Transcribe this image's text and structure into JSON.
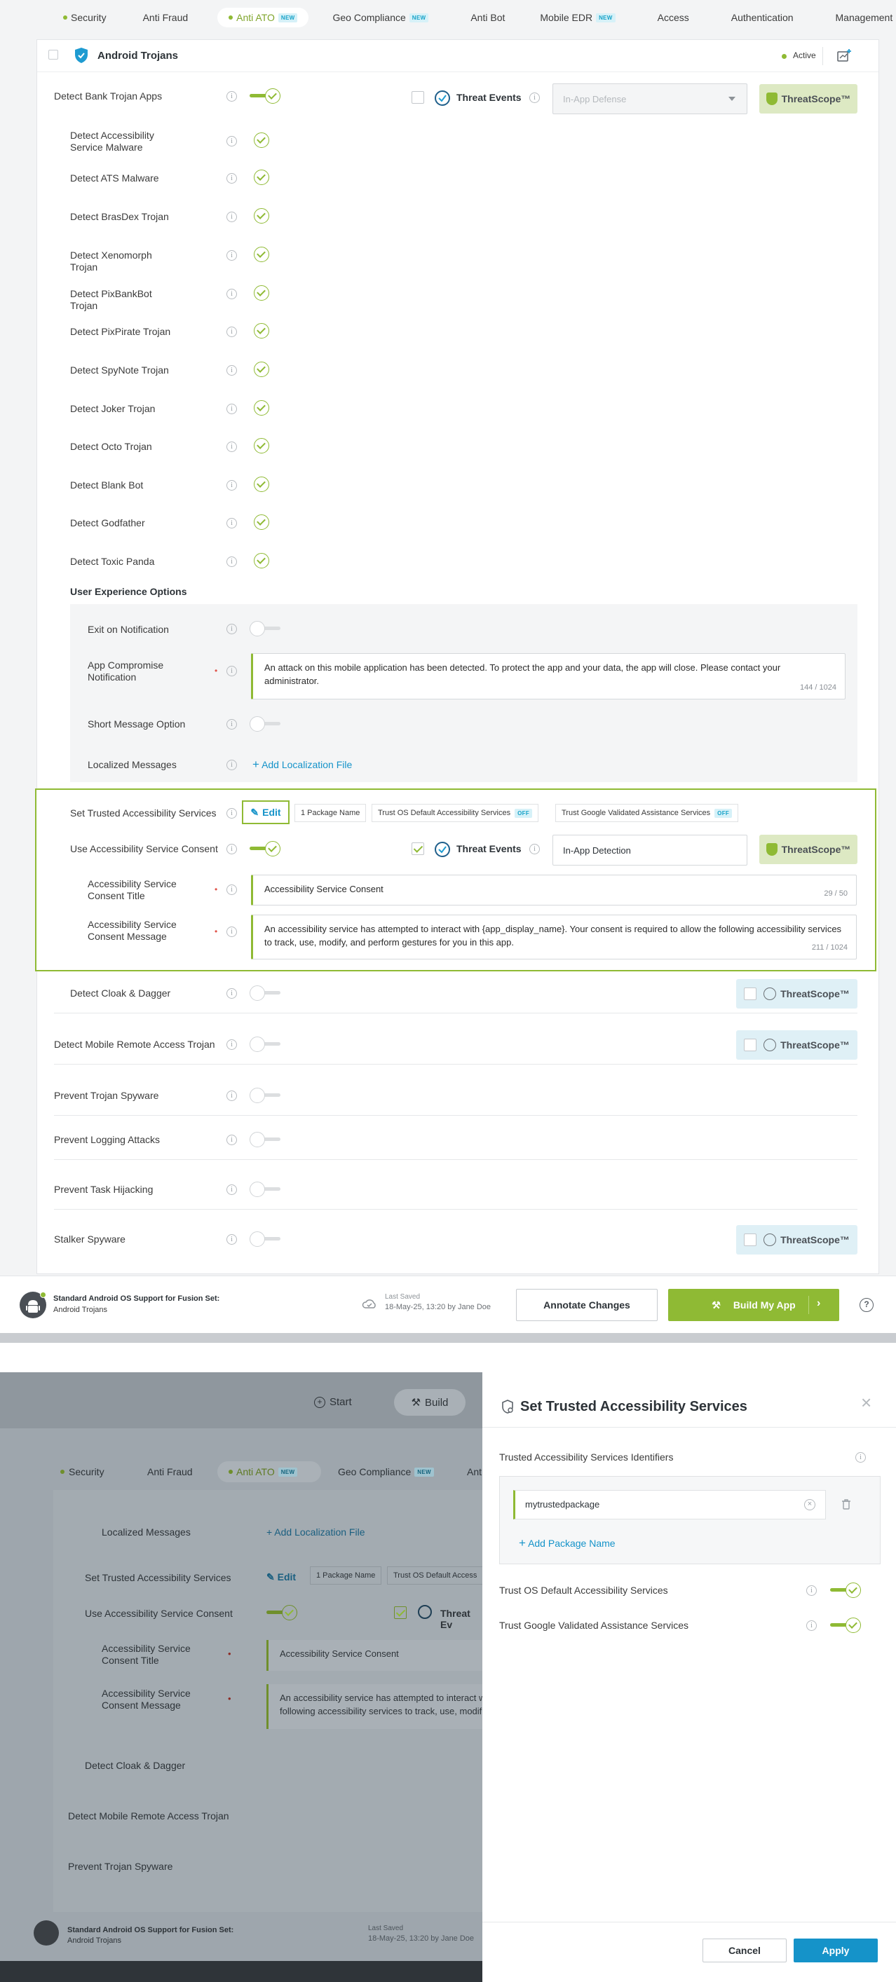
{
  "tabs": [
    {
      "label": "Security",
      "dot": true
    },
    {
      "label": "Anti Fraud"
    },
    {
      "label": "Anti ATO",
      "dot": true,
      "badge": "NEW",
      "active": true
    },
    {
      "label": "Geo Compliance",
      "badge": "NEW"
    },
    {
      "label": "Anti Bot"
    },
    {
      "label": "Mobile EDR",
      "badge": "NEW"
    },
    {
      "label": "Access"
    },
    {
      "label": "Authentication"
    },
    {
      "label": "Management"
    }
  ],
  "section": {
    "title": "Android Trojans",
    "status": "Active"
  },
  "bank": {
    "label": "Detect Bank Trojan Apps",
    "threat_events": "Threat Events",
    "select_placeholder": "In-App Defense",
    "threatscope": "ThreatScope™"
  },
  "trojans": [
    "Detect Accessibility Service Malware",
    "Detect ATS Malware",
    "Detect BrasDex Trojan",
    "Detect Xenomorph Trojan",
    "Detect PixBankBot Trojan",
    "Detect PixPirate Trojan",
    "Detect SpyNote Trojan",
    "Detect Joker Trojan",
    "Detect Octo Trojan",
    "Detect Blank Bot",
    "Detect Godfather",
    "Detect Toxic Panda"
  ],
  "ux": {
    "heading": "User Experience Options",
    "exit_label": "Exit on Notification",
    "compromise_label": "App Compromise Notification",
    "compromise_text": "An attack on this mobile application has been detected. To protect the app and your data, the app will close. Please contact your administrator.",
    "compromise_count": "144 / 1024",
    "short_label": "Short Message Option",
    "localized_label": "Localized Messages",
    "add_localization": "Add Localization File"
  },
  "trusted": {
    "label": "Set Trusted Accessibility Services",
    "edit": "Edit",
    "chip_pkg": "1 Package Name",
    "chip_os": "Trust OS Default Accessibility Services",
    "chip_google": "Trust Google Validated Assistance Services",
    "off": "OFF"
  },
  "consent": {
    "label": "Use Accessibility Service Consent",
    "threat_events": "Threat Events",
    "select_value": "In-App Detection",
    "threatscope": "ThreatScope™",
    "title_label": "Accessibility Service Consent Title",
    "title_value": "Accessibility Service Consent",
    "title_count": "29 / 50",
    "msg_label": "Accessibility Service Consent Message",
    "msg_value": "An accessibility service has attempted to interact with {app_display_name}. Your consent is required to allow the following accessibility services to track, use, modify, and perform gestures for you in this app.",
    "msg_count": "211 / 1024"
  },
  "lower": [
    {
      "label": "Detect Cloak & Dagger",
      "indent": true,
      "threatscope": "ThreatScope™"
    },
    {
      "label": "Detect Mobile Remote Access Trojan",
      "threatscope": "ThreatScope™"
    },
    {
      "label": "Prevent Trojan Spyware"
    },
    {
      "label": "Prevent Logging Attacks"
    },
    {
      "label": "Prevent Task Hijacking"
    },
    {
      "label": "Stalker Spyware",
      "threatscope": "ThreatScope™"
    }
  ],
  "footer": {
    "support_line1": "Standard Android OS Support for Fusion Set:",
    "support_line2": "Android Trojans",
    "last_saved": "Last Saved",
    "saved_detail": "18-May-25, 13:20 by Jane Doe",
    "annotate": "Annotate Changes",
    "build": "Build My App",
    "help": "?"
  },
  "bottom": {
    "start": "Start",
    "build": "Build",
    "tabs": [
      "Security",
      "Anti Fraud",
      "Anti ATO",
      "Geo Compliance",
      "Ant"
    ],
    "new_badge": "NEW",
    "localized": "Localized Messages",
    "add_localization": "Add Localization File",
    "trusted": "Set Trusted Accessibility Services",
    "edit": "Edit",
    "chip_pkg": "1 Package Name",
    "chip_os": "Trust OS Default Access",
    "consent": "Use Accessibility Service Consent",
    "threat_events": "Threat Ev",
    "title_label": "Accessibility Service Consent Title",
    "title_value": "Accessibility Service Consent",
    "msg_label": "Accessibility Service Consent Message",
    "msg_line1": "An accessibility service has attempted to interact w",
    "msg_line2": "following accessibility services to track, use, modif",
    "cloak": "Detect Cloak & Dagger",
    "rat": "Detect Mobile Remote Access Trojan",
    "spyware": "Prevent Trojan Spyware",
    "support_line1": "Standard Android OS Support for Fusion Set:",
    "support_line2": "Android Trojans",
    "last_saved": "Last Saved",
    "saved_detail": "18-May-25, 13:20 by Jane Doe"
  },
  "drawer": {
    "title": "Set Trusted Accessibility Services",
    "close": "×",
    "identifiers_label": "Trusted Accessibility Services Identifiers",
    "package_value": "mytrustedpackage",
    "add_package": "Add Package Name",
    "os_label": "Trust OS Default Accessibility Services",
    "google_label": "Trust Google Validated Assistance Services",
    "cancel": "Cancel",
    "apply": "Apply"
  },
  "colors": {
    "accent": "#8fba34",
    "blue": "#1593c9",
    "active_dot": "#8fba34"
  }
}
